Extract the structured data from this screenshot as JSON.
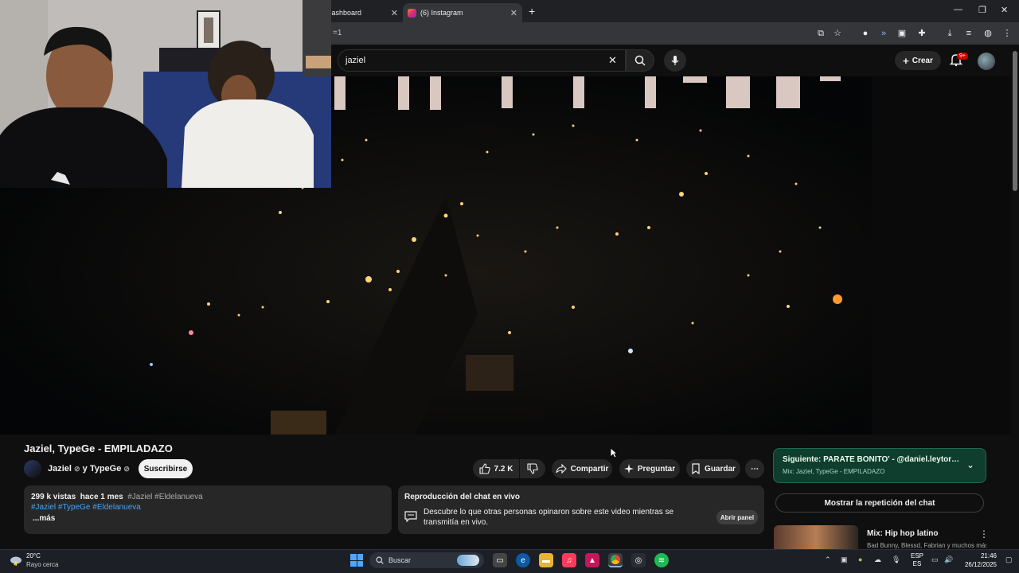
{
  "browser": {
    "tabs": [
      {
        "label": "Dashboard"
      },
      {
        "label": "(6) Instagram"
      }
    ],
    "url_fragment": "=1"
  },
  "youtube": {
    "search": {
      "value": "jaziel"
    },
    "create_label": "Crear",
    "notifications_badge": "9+"
  },
  "video": {
    "title": "Jaziel, TypeGe - EMPILADAZO",
    "channel": "Jaziel",
    "channel_joiner": "y TypeGe",
    "subscribe_label": "Suscribirse",
    "likes": "7.2 K",
    "share_label": "Compartir",
    "ask_label": "Preguntar",
    "save_label": "Guardar",
    "description": {
      "views": "299 k vistas",
      "age": "hace 1 mes",
      "inline_tags": "#Jaziel #Eldelanueva",
      "tags": "#Jaziel #TypeGe #Eldelanueva",
      "more_label": "...más"
    },
    "chat_replay": {
      "title": "Reproducción del chat en vivo",
      "description": "Descubre lo que otras personas opinaron sobre este video mientras se transmitía en vivo.",
      "open_label": "Abrir panel"
    }
  },
  "sidebar": {
    "next": {
      "title": "Siguiente: PARATE BONITO' - @daniel.leytor $ @yec...",
      "subtitle": "Mix: Jaziel, TypeGe - EMPILADAZO"
    },
    "replay_label": "Mostrar la repetición del chat",
    "mix": {
      "title": "Mix: Hip hop latino",
      "subtitle": "Bad Bunny, Blessd, Fabrian y muchos más"
    }
  },
  "taskbar": {
    "weather_temp": "20°C",
    "weather_desc": "Rayo cerca",
    "search_label": "Buscar",
    "lang": "ESP\nES",
    "time": "21:46",
    "date": "26/12/2025"
  },
  "colors": {
    "next_bg": "#0f3d2e",
    "link": "#3ea6ff",
    "badge": "#cc0000"
  }
}
